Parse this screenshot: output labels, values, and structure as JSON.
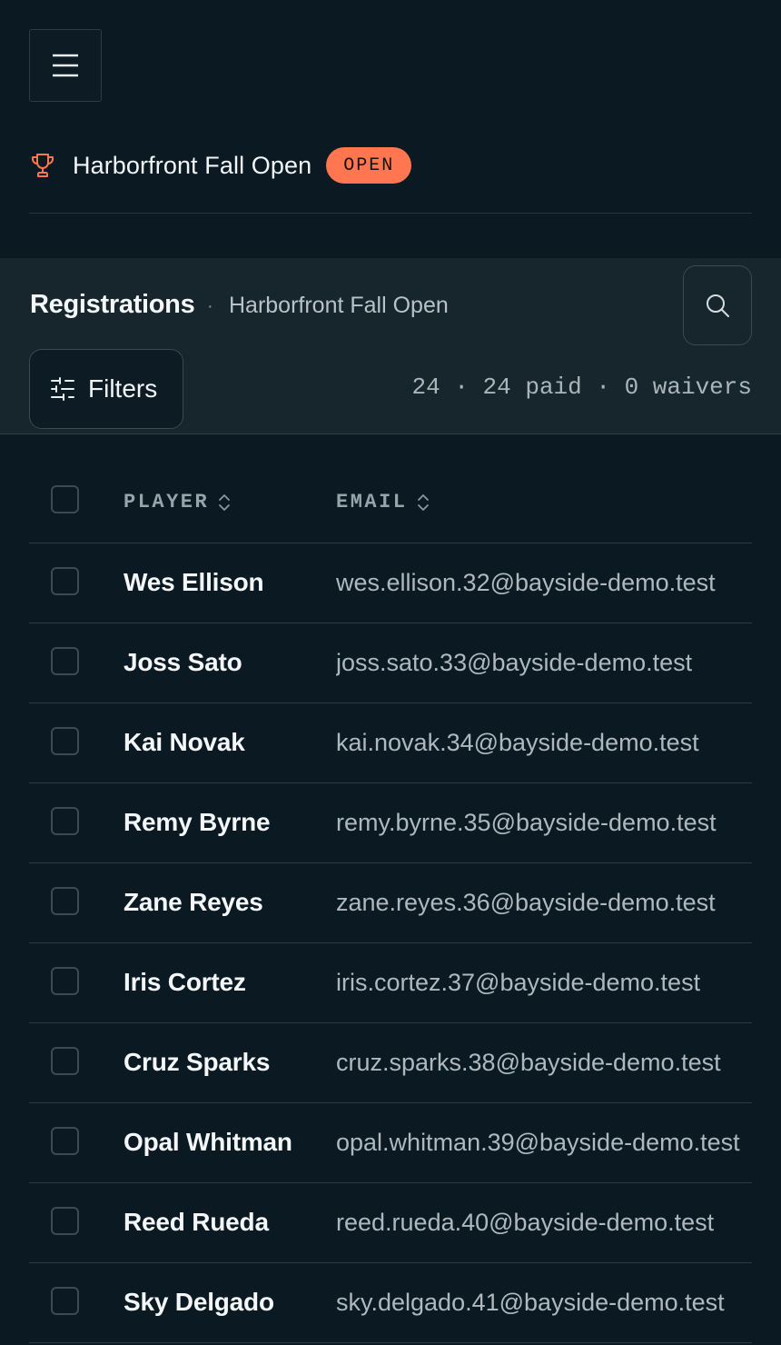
{
  "header": {
    "menu_icon": "hamburger-menu-icon",
    "event_icon": "trophy-icon",
    "event_title": "Harborfront Fall Open",
    "status_badge": "OPEN",
    "colors": {
      "background": "#0b1a22",
      "accent": "#ff7650"
    }
  },
  "panel": {
    "title": "Registrations",
    "separator": "·",
    "subtitle": "Harborfront Fall Open",
    "search_icon": "search-icon",
    "filters_label": "Filters",
    "filters_icon": "sliders-icon",
    "summary": "24 · 24 paid · 0 waivers"
  },
  "table": {
    "columns": [
      {
        "label": "PLAYER",
        "sort_icon": "sort-icon"
      },
      {
        "label": "EMAIL",
        "sort_icon": "sort-icon"
      }
    ],
    "rows": [
      {
        "player": "Wes Ellison",
        "email": "wes.ellison.32@bayside-demo.test"
      },
      {
        "player": "Joss Sato",
        "email": "joss.sato.33@bayside-demo.test"
      },
      {
        "player": "Kai Novak",
        "email": "kai.novak.34@bayside-demo.test"
      },
      {
        "player": "Remy Byrne",
        "email": "remy.byrne.35@bayside-demo.test"
      },
      {
        "player": "Zane Reyes",
        "email": "zane.reyes.36@bayside-demo.test"
      },
      {
        "player": "Iris Cortez",
        "email": "iris.cortez.37@bayside-demo.test"
      },
      {
        "player": "Cruz Sparks",
        "email": "cruz.sparks.38@bayside-demo.test"
      },
      {
        "player": "Opal Whitman",
        "email": "opal.whitman.39@bayside-demo.test"
      },
      {
        "player": "Reed Rueda",
        "email": "reed.rueda.40@bayside-demo.test"
      },
      {
        "player": "Sky Delgado",
        "email": "sky.delgado.41@bayside-demo.test"
      }
    ]
  }
}
